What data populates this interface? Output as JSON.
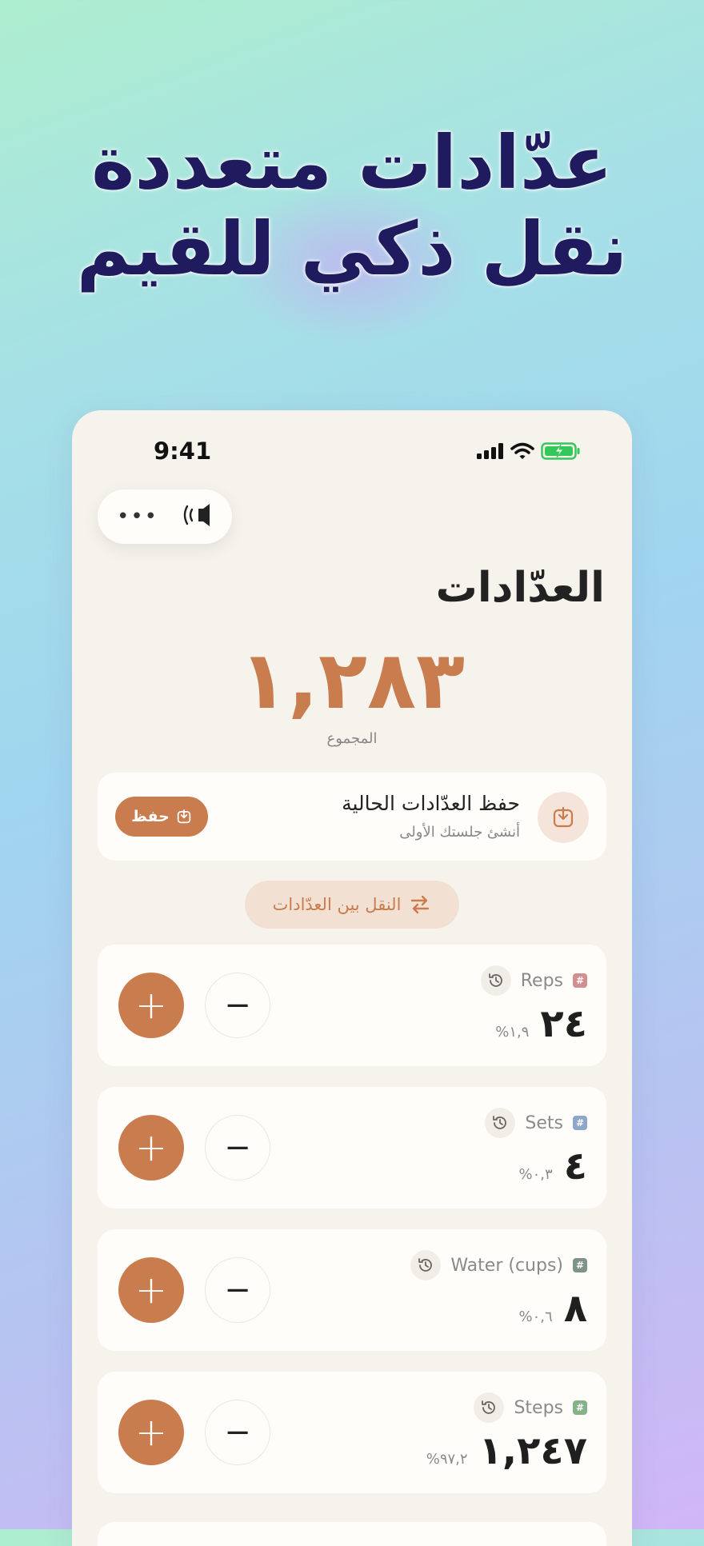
{
  "headline": {
    "line1": "عدّادات متعددة",
    "line2": "نقل ذكي للقيم"
  },
  "status_bar": {
    "time": "9:41"
  },
  "toolbar": {
    "more_icon": "ellipsis-icon",
    "sound_icon": "speaker-icon"
  },
  "page": {
    "title": "العدّادات",
    "total": "١,٢٨٣",
    "total_label": "المجموع"
  },
  "save_card": {
    "title": "حفظ العدّادات الحالية",
    "subtitle": "أنشئ جلستك الأولى",
    "button_label": "حفظ"
  },
  "transfer": {
    "label": "النقل بين العدّادات"
  },
  "counters": [
    {
      "name": "Reps",
      "value": "٢٤",
      "percent": "١,٩%",
      "tag_color": "#d38f8f"
    },
    {
      "name": "Sets",
      "value": "٤",
      "percent": "٠,٣%",
      "tag_color": "#8da6c9"
    },
    {
      "name": "Water (cups)",
      "value": "٨",
      "percent": "٠,٦%",
      "tag_color": "#7f9488"
    },
    {
      "name": "Steps",
      "value": "١,٢٤٧",
      "percent": "٩٧,٢%",
      "tag_color": "#86b28a"
    }
  ],
  "counter_controls": {
    "plus": "+",
    "minus": "−"
  },
  "colors": {
    "accent": "#c97c4d",
    "headline": "#201b5e",
    "card": "#fffdf9",
    "screen": "#f6f2ec"
  }
}
